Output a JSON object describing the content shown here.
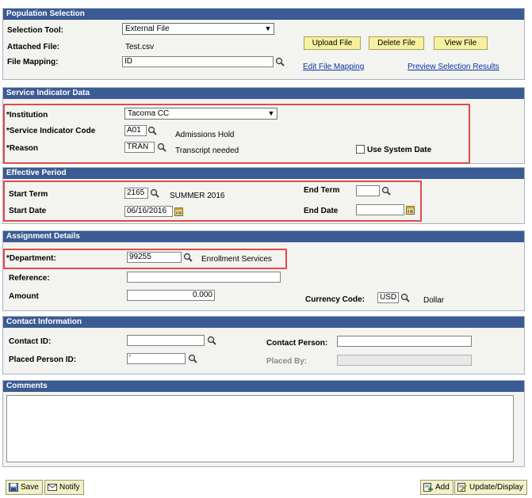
{
  "population_selection": {
    "header": "Population Selection",
    "selection_tool_label": "Selection Tool:",
    "selection_tool_value": "External File",
    "attached_file_label": "Attached File:",
    "attached_file_value": "Test.csv",
    "file_mapping_label": "File Mapping:",
    "file_mapping_value": "ID",
    "upload_file": "Upload File",
    "delete_file": "Delete File",
    "view_file": "View File",
    "edit_file_mapping": "Edit File Mapping",
    "preview_selection_results": "Preview Selection Results"
  },
  "service_indicator": {
    "header": "Service Indicator Data",
    "institution_label": "*Institution",
    "institution_value": "Tacoma CC",
    "code_label": "*Service Indicator Code",
    "code_value": "A01",
    "code_desc": "Admissions Hold",
    "reason_label": "*Reason",
    "reason_value": "TRAN",
    "reason_desc": "Transcript needed",
    "use_system_date": "Use System Date"
  },
  "effective_period": {
    "header": "Effective Period",
    "start_term_label": "Start Term",
    "start_term_value": "2165",
    "start_term_desc": "SUMMER 2016",
    "end_term_label": "End Term",
    "end_term_value": "",
    "start_date_label": "Start Date",
    "start_date_value": "06/16/2016",
    "end_date_label": "End Date",
    "end_date_value": ""
  },
  "assignment": {
    "header": "Assignment Details",
    "department_label": "*Department:",
    "department_value": "99255",
    "department_desc": "Enrollment Services",
    "reference_label": "Reference:",
    "reference_value": "",
    "amount_label": "Amount",
    "amount_value": "0.000",
    "currency_label": "Currency Code:",
    "currency_value": "USD",
    "currency_desc": "Dollar"
  },
  "contact": {
    "header": "Contact Information",
    "contact_id_label": "Contact ID:",
    "contact_id_value": "",
    "contact_person_label": "Contact Person:",
    "contact_person_value": "",
    "placed_person_label": "Placed Person ID:",
    "placed_person_value": "'",
    "placed_by_label": "Placed By:",
    "placed_by_value": ""
  },
  "comments": {
    "header": "Comments",
    "value": ""
  },
  "footer": {
    "save": "Save",
    "notify": "Notify",
    "add": "Add",
    "update_display": "Update/Display"
  },
  "colors": {
    "header_bg": "#3a5b93",
    "section_bg": "#f3f3ef",
    "highlight_box": "#e04a4a",
    "button_yellow": "#f5f1a0",
    "link": "#0a33a6"
  },
  "icons": {
    "lookup": "magnifier-icon",
    "calendar": "calendar-icon",
    "dropdown": "chevron-down-icon",
    "save": "save-icon",
    "notify": "notify-icon",
    "add": "add-icon",
    "update": "update-icon"
  }
}
